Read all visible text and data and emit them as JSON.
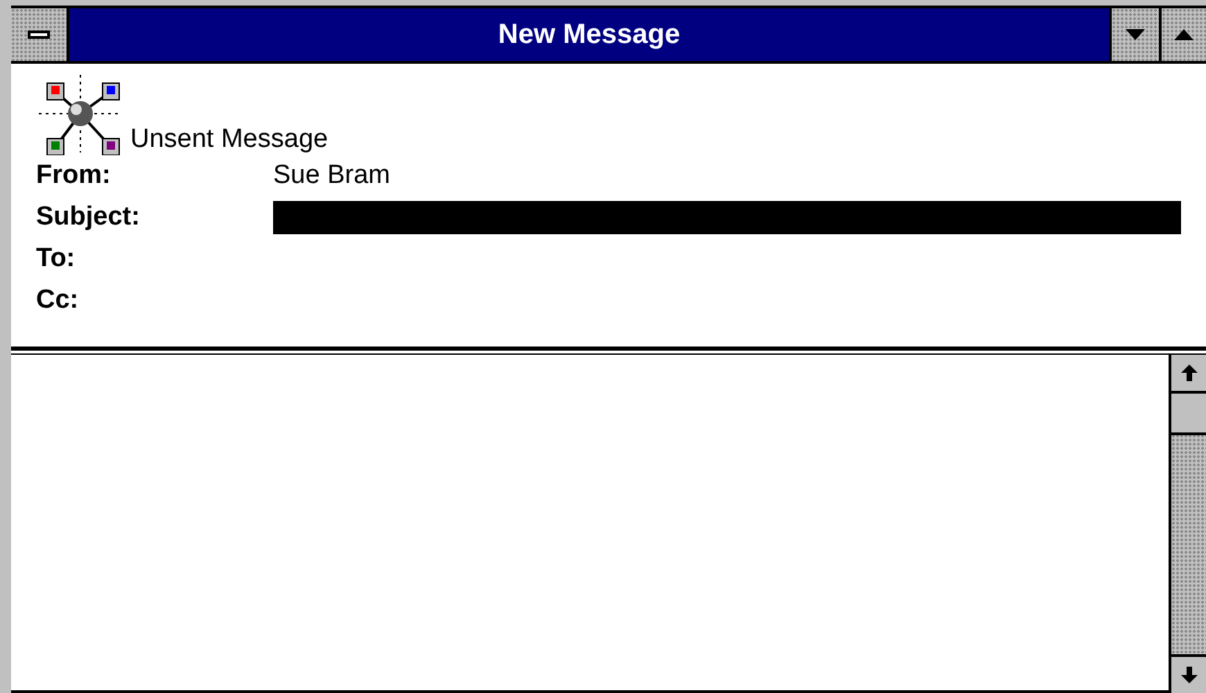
{
  "window": {
    "title": "New Message"
  },
  "header": {
    "status": "Unsent Message"
  },
  "fields": [
    {
      "label": "From:",
      "value": "Sue Bram",
      "focused": false
    },
    {
      "label": "Subject:",
      "focused": true
    },
    {
      "label": "To:"
    },
    {
      "label": "Cc:"
    }
  ]
}
